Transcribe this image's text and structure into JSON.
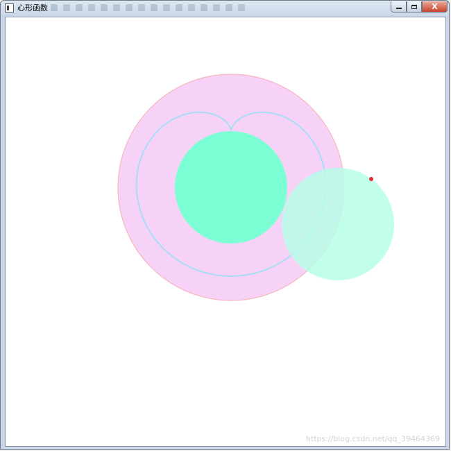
{
  "window": {
    "title": "心形函数",
    "controls": {
      "minimize_icon": "minimize-icon",
      "maximize_icon": "maximize-icon",
      "close_icon": "close-icon",
      "close_glyph": "X"
    }
  },
  "scene": {
    "cardioid_color": "#a8ddf6",
    "big_circle_fill": "#f5d2f6",
    "big_circle_stroke": "#f7b6be",
    "inner_circle_fill": "#7cffd4",
    "rolling_circle_fill": "#b4ffe6",
    "point_color": "#e0282e"
  },
  "watermark": "https://blog.csdn.net/qq_39464369"
}
